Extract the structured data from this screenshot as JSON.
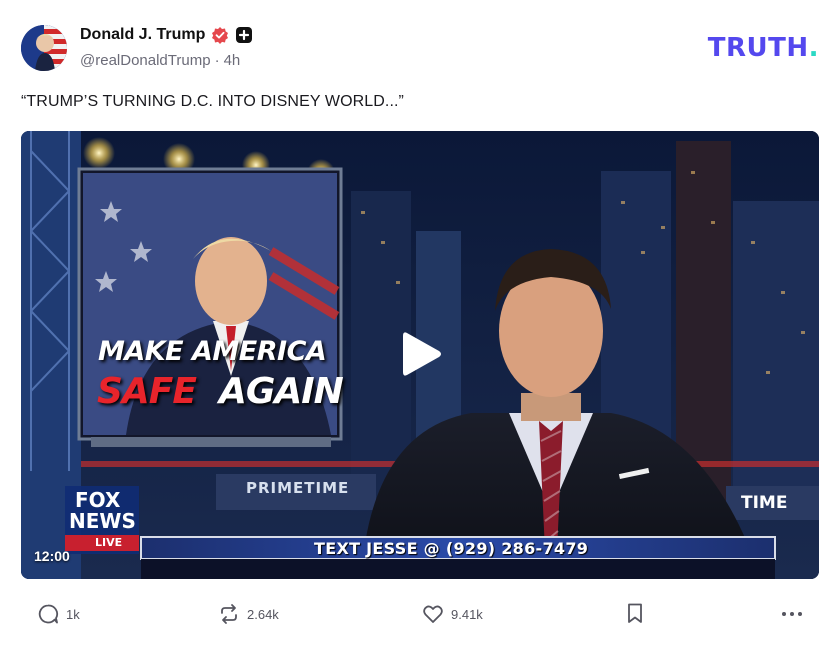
{
  "post": {
    "author": {
      "display_name": "Donald J. Trump",
      "handle": "@realDonaldTrump",
      "separator": "·",
      "time_ago": "4h"
    },
    "brand": {
      "name": "TRUTH",
      "dot": ".",
      "color": "#5448ee",
      "dot_color": "#2bd9c4"
    },
    "text": "“TRUMP’S TURNING D.C. INTO DISNEY WORLD...”",
    "media": {
      "type": "video",
      "duration": "12:00",
      "overlay": {
        "headline_line1": "MAKE AMERICA",
        "headline_safe": "SAFE",
        "headline_again": "AGAIN",
        "show_title": "PRIMETIME",
        "show_title_right": "TIME",
        "ticker": "TEXT JESSE @ (929) 286-7479",
        "network_top": "FOX",
        "network_bottom": "NEWS",
        "network_channel": "LIVE"
      }
    },
    "actions": {
      "replies": "1k",
      "reposts": "2.64k",
      "likes": "9.41k"
    }
  },
  "icons": {
    "verified": "verified-badge-icon",
    "plus": "plus-badge-icon",
    "play": "play-icon",
    "reply": "speech-bubble-icon",
    "repost": "repost-arrows-icon",
    "like": "heart-icon",
    "bookmark": "bookmark-icon",
    "more": "more-dots-icon"
  },
  "colors": {
    "verified_badge": "#e5484d",
    "action_gray": "#55555f"
  }
}
